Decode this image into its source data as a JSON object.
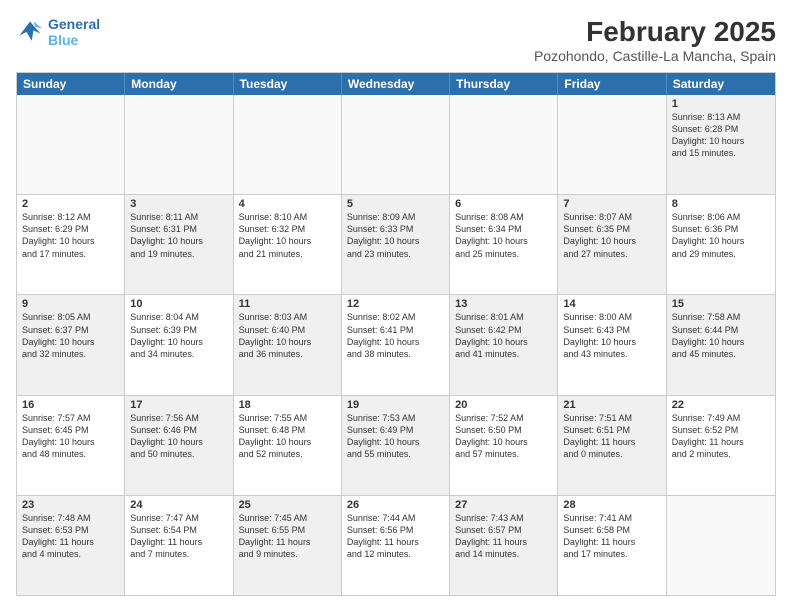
{
  "logo": {
    "line1": "General",
    "line2": "Blue"
  },
  "title": "February 2025",
  "subtitle": "Pozohondo, Castille-La Mancha, Spain",
  "headers": [
    "Sunday",
    "Monday",
    "Tuesday",
    "Wednesday",
    "Thursday",
    "Friday",
    "Saturday"
  ],
  "weeks": [
    [
      {
        "num": "",
        "text": "",
        "empty": true
      },
      {
        "num": "",
        "text": "",
        "empty": true
      },
      {
        "num": "",
        "text": "",
        "empty": true
      },
      {
        "num": "",
        "text": "",
        "empty": true
      },
      {
        "num": "",
        "text": "",
        "empty": true
      },
      {
        "num": "",
        "text": "",
        "empty": true
      },
      {
        "num": "1",
        "text": "Sunrise: 8:13 AM\nSunset: 6:28 PM\nDaylight: 10 hours\nand 15 minutes.",
        "shaded": true
      }
    ],
    [
      {
        "num": "2",
        "text": "Sunrise: 8:12 AM\nSunset: 6:29 PM\nDaylight: 10 hours\nand 17 minutes.",
        "shaded": false
      },
      {
        "num": "3",
        "text": "Sunrise: 8:11 AM\nSunset: 6:31 PM\nDaylight: 10 hours\nand 19 minutes.",
        "shaded": true
      },
      {
        "num": "4",
        "text": "Sunrise: 8:10 AM\nSunset: 6:32 PM\nDaylight: 10 hours\nand 21 minutes.",
        "shaded": false
      },
      {
        "num": "5",
        "text": "Sunrise: 8:09 AM\nSunset: 6:33 PM\nDaylight: 10 hours\nand 23 minutes.",
        "shaded": true
      },
      {
        "num": "6",
        "text": "Sunrise: 8:08 AM\nSunset: 6:34 PM\nDaylight: 10 hours\nand 25 minutes.",
        "shaded": false
      },
      {
        "num": "7",
        "text": "Sunrise: 8:07 AM\nSunset: 6:35 PM\nDaylight: 10 hours\nand 27 minutes.",
        "shaded": true
      },
      {
        "num": "8",
        "text": "Sunrise: 8:06 AM\nSunset: 6:36 PM\nDaylight: 10 hours\nand 29 minutes.",
        "shaded": false
      }
    ],
    [
      {
        "num": "9",
        "text": "Sunrise: 8:05 AM\nSunset: 6:37 PM\nDaylight: 10 hours\nand 32 minutes.",
        "shaded": true
      },
      {
        "num": "10",
        "text": "Sunrise: 8:04 AM\nSunset: 6:39 PM\nDaylight: 10 hours\nand 34 minutes.",
        "shaded": false
      },
      {
        "num": "11",
        "text": "Sunrise: 8:03 AM\nSunset: 6:40 PM\nDaylight: 10 hours\nand 36 minutes.",
        "shaded": true
      },
      {
        "num": "12",
        "text": "Sunrise: 8:02 AM\nSunset: 6:41 PM\nDaylight: 10 hours\nand 38 minutes.",
        "shaded": false
      },
      {
        "num": "13",
        "text": "Sunrise: 8:01 AM\nSunset: 6:42 PM\nDaylight: 10 hours\nand 41 minutes.",
        "shaded": true
      },
      {
        "num": "14",
        "text": "Sunrise: 8:00 AM\nSunset: 6:43 PM\nDaylight: 10 hours\nand 43 minutes.",
        "shaded": false
      },
      {
        "num": "15",
        "text": "Sunrise: 7:58 AM\nSunset: 6:44 PM\nDaylight: 10 hours\nand 45 minutes.",
        "shaded": true
      }
    ],
    [
      {
        "num": "16",
        "text": "Sunrise: 7:57 AM\nSunset: 6:45 PM\nDaylight: 10 hours\nand 48 minutes.",
        "shaded": false
      },
      {
        "num": "17",
        "text": "Sunrise: 7:56 AM\nSunset: 6:46 PM\nDaylight: 10 hours\nand 50 minutes.",
        "shaded": true
      },
      {
        "num": "18",
        "text": "Sunrise: 7:55 AM\nSunset: 6:48 PM\nDaylight: 10 hours\nand 52 minutes.",
        "shaded": false
      },
      {
        "num": "19",
        "text": "Sunrise: 7:53 AM\nSunset: 6:49 PM\nDaylight: 10 hours\nand 55 minutes.",
        "shaded": true
      },
      {
        "num": "20",
        "text": "Sunrise: 7:52 AM\nSunset: 6:50 PM\nDaylight: 10 hours\nand 57 minutes.",
        "shaded": false
      },
      {
        "num": "21",
        "text": "Sunrise: 7:51 AM\nSunset: 6:51 PM\nDaylight: 11 hours\nand 0 minutes.",
        "shaded": true
      },
      {
        "num": "22",
        "text": "Sunrise: 7:49 AM\nSunset: 6:52 PM\nDaylight: 11 hours\nand 2 minutes.",
        "shaded": false
      }
    ],
    [
      {
        "num": "23",
        "text": "Sunrise: 7:48 AM\nSunset: 6:53 PM\nDaylight: 11 hours\nand 4 minutes.",
        "shaded": true
      },
      {
        "num": "24",
        "text": "Sunrise: 7:47 AM\nSunset: 6:54 PM\nDaylight: 11 hours\nand 7 minutes.",
        "shaded": false
      },
      {
        "num": "25",
        "text": "Sunrise: 7:45 AM\nSunset: 6:55 PM\nDaylight: 11 hours\nand 9 minutes.",
        "shaded": true
      },
      {
        "num": "26",
        "text": "Sunrise: 7:44 AM\nSunset: 6:56 PM\nDaylight: 11 hours\nand 12 minutes.",
        "shaded": false
      },
      {
        "num": "27",
        "text": "Sunrise: 7:43 AM\nSunset: 6:57 PM\nDaylight: 11 hours\nand 14 minutes.",
        "shaded": true
      },
      {
        "num": "28",
        "text": "Sunrise: 7:41 AM\nSunset: 6:58 PM\nDaylight: 11 hours\nand 17 minutes.",
        "shaded": false
      },
      {
        "num": "",
        "text": "",
        "empty": true
      }
    ]
  ]
}
